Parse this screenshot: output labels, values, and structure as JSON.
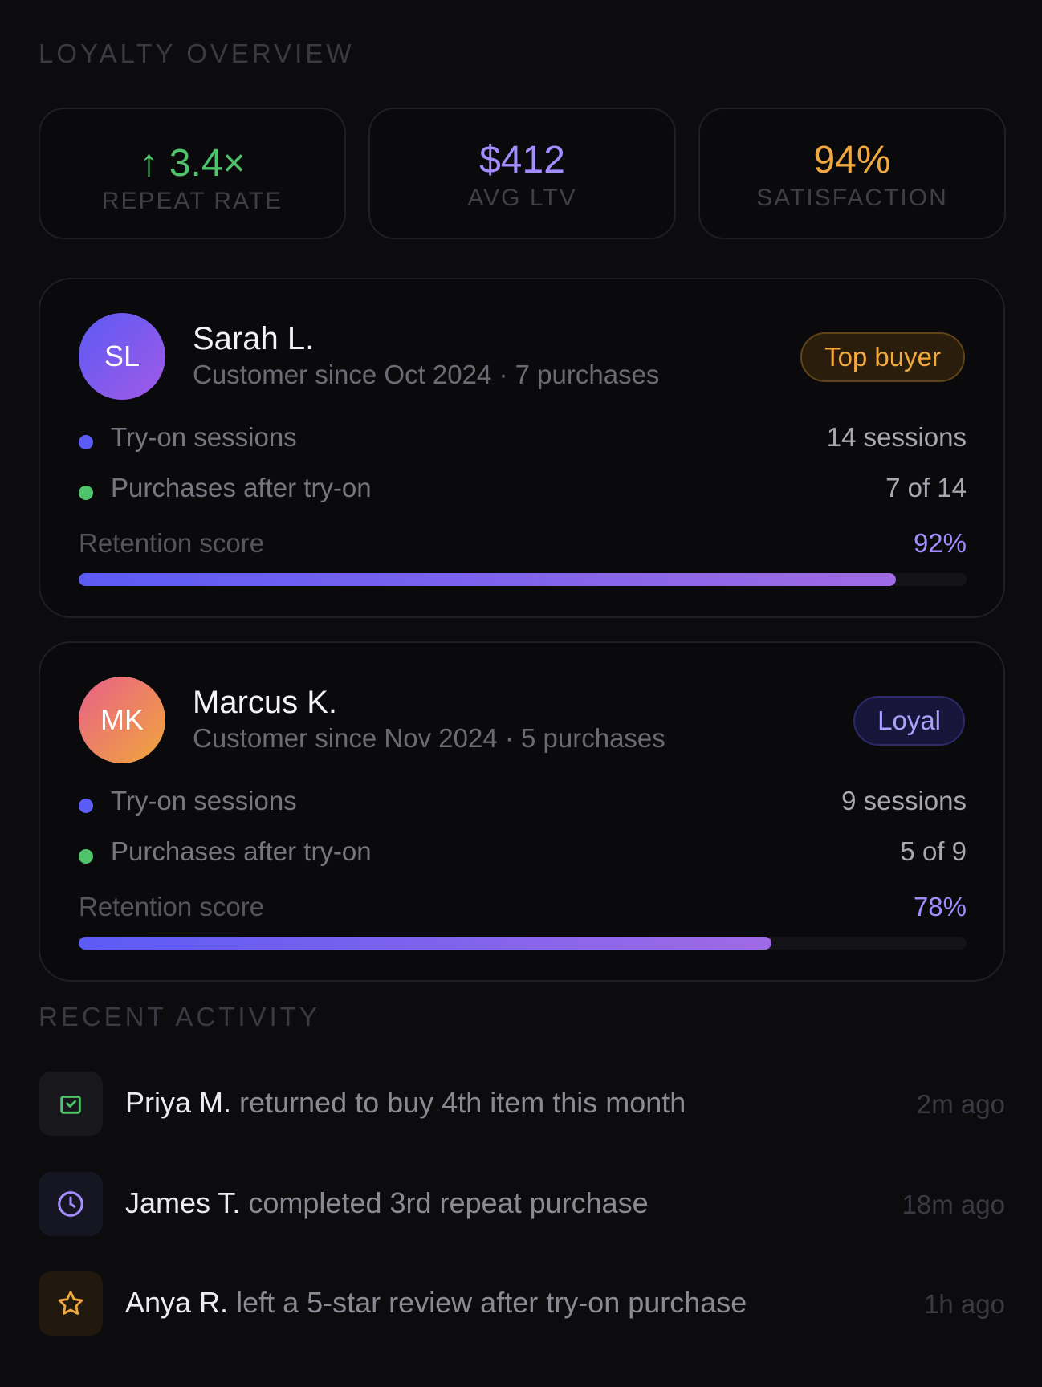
{
  "overview": {
    "title": "LOYALTY OVERVIEW",
    "stats": [
      {
        "value": "↑ 3.4×",
        "label": "REPEAT RATE",
        "color": "#4fc46b"
      },
      {
        "value": "$412",
        "label": "AVG LTV",
        "color": "#a38cff"
      },
      {
        "value": "94%",
        "label": "SATISFACTION",
        "color": "#f2a83e"
      }
    ]
  },
  "customers": [
    {
      "initials": "SL",
      "name": "Sarah L.",
      "subtitle": "Customer since Oct 2024 · 7 purchases",
      "badge": "Top buyer",
      "tryon_label": "Try-on sessions",
      "tryon_value": "14 sessions",
      "purchases_label": "Purchases after try-on",
      "purchases_value": "7 of 14",
      "retention_label": "Retention score",
      "retention_value": "92%",
      "retention_fraction": 0.92
    },
    {
      "initials": "MK",
      "name": "Marcus K.",
      "subtitle": "Customer since Nov 2024 · 5 purchases",
      "badge": "Loyal",
      "tryon_label": "Try-on sessions",
      "tryon_value": "9 sessions",
      "purchases_label": "Purchases after try-on",
      "purchases_value": "5 of 9",
      "retention_label": "Retention score",
      "retention_value": "78%",
      "retention_fraction": 0.78
    }
  ],
  "activity": {
    "title": "RECENT ACTIVITY",
    "items": [
      {
        "who": "Priya M.",
        "text": " returned to buy 4th item this month",
        "time": "2m ago",
        "icon": "shopping-bag-icon"
      },
      {
        "who": "James T.",
        "text": " completed 3rd repeat purchase",
        "time": "18m ago",
        "icon": "clock-icon"
      },
      {
        "who": "Anya R.",
        "text": " left a 5-star review after try-on purchase",
        "time": "1h ago",
        "icon": "star-icon"
      }
    ]
  }
}
